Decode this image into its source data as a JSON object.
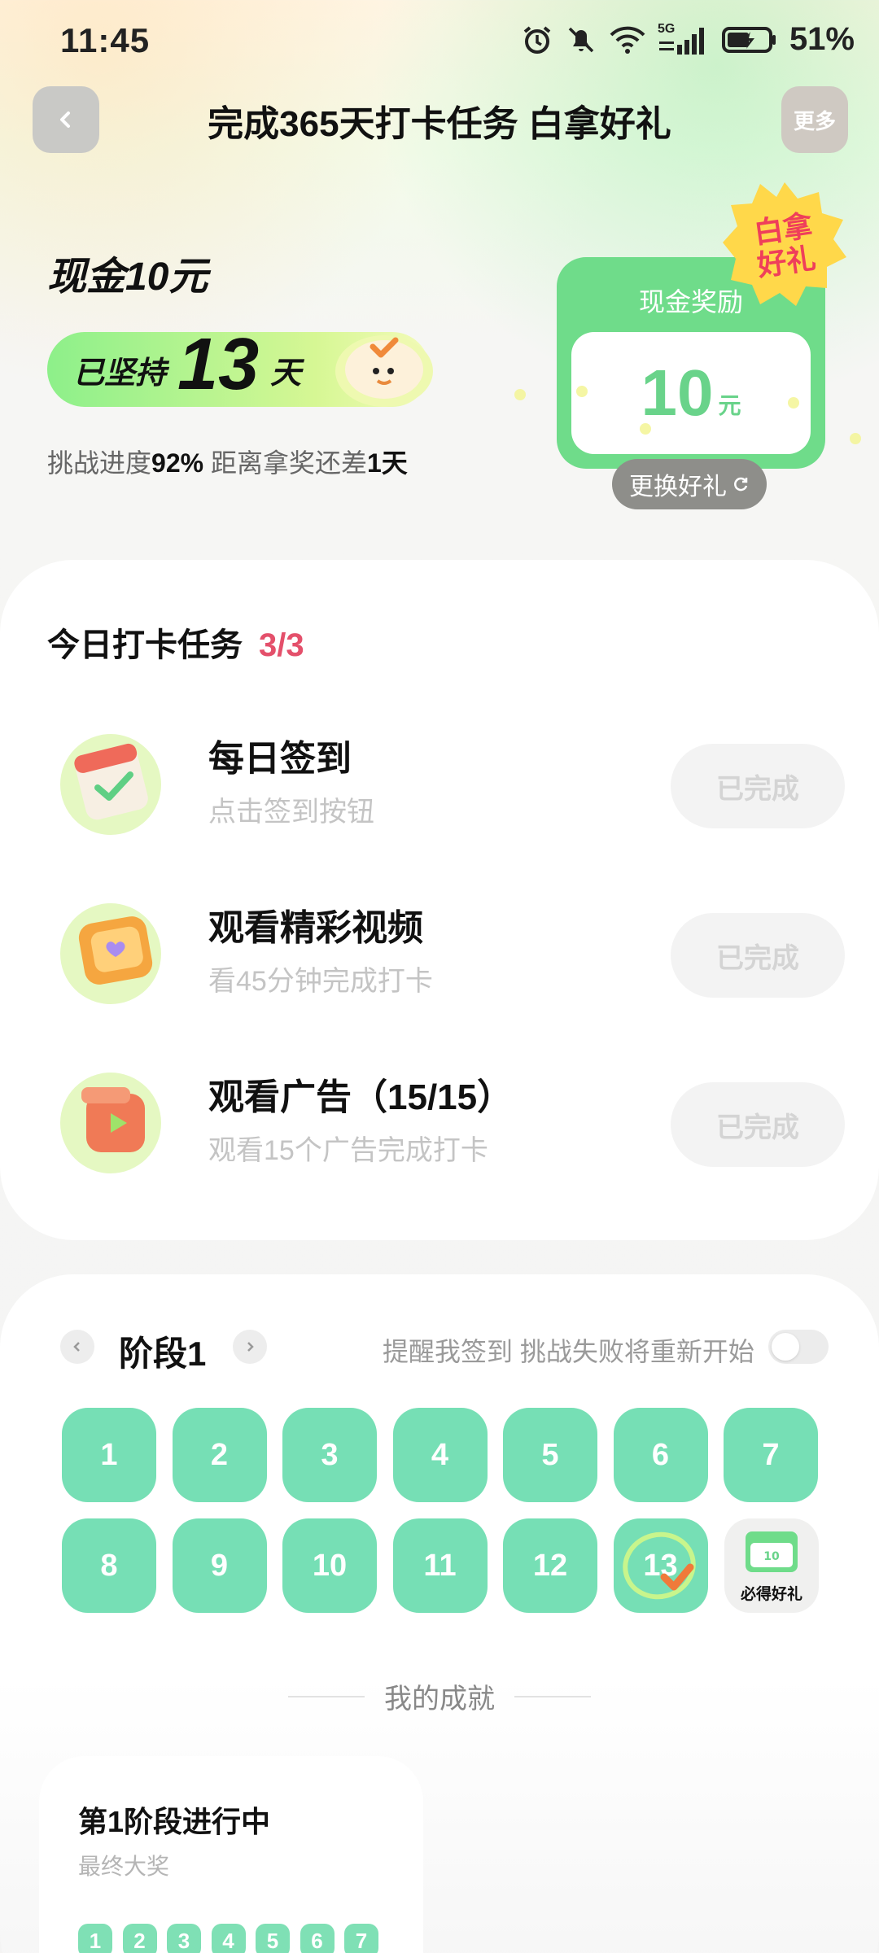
{
  "status_bar": {
    "time": "11:45",
    "signal_label": "5G",
    "battery": "51%"
  },
  "header": {
    "title": "完成365天打卡任务 白拿好礼",
    "more_label": "更多"
  },
  "hero": {
    "cash_title": "现金10元",
    "streak_prefix": "已坚持",
    "streak_days": "13",
    "streak_suffix": "天",
    "progress_label": "挑战进度",
    "progress_value": "92%",
    "progress_gap": "距离拿奖还差",
    "progress_remaining": "1天",
    "reward": {
      "label": "现金奖励",
      "amount": "10",
      "unit": "元"
    },
    "badge_line1": "白拿",
    "badge_line2": "好礼",
    "change_label": "更换好礼"
  },
  "tasks": {
    "title": "今日打卡任务",
    "count": "3/3",
    "items": [
      {
        "name": "每日签到",
        "desc": "点击签到按钮",
        "status": "已完成",
        "icon": "calendar-icon"
      },
      {
        "name": "观看精彩视频",
        "desc": "看45分钟完成打卡",
        "status": "已完成",
        "icon": "video-icon"
      },
      {
        "name": "观看广告（15/15）",
        "desc": "观看15个广告完成打卡",
        "status": "已完成",
        "icon": "ad-play-icon"
      }
    ]
  },
  "stage": {
    "title": "阶段1",
    "reminder": "提醒我签到 挑战失败将重新开始",
    "reminder_enabled": false,
    "days": [
      "1",
      "2",
      "3",
      "4",
      "5",
      "6",
      "7",
      "8",
      "9",
      "10",
      "11",
      "12",
      "13"
    ],
    "current_day": "13",
    "gift_label": "必得好礼",
    "gift_mini_amount": "10"
  },
  "achievements": {
    "title": "我的成就",
    "card_title": "第1阶段进行中",
    "card_sub": "最终大奖",
    "mini_days": [
      "1",
      "2",
      "3",
      "4",
      "5",
      "6",
      "7"
    ]
  },
  "colors": {
    "accent_green": "#76dfb5",
    "reward_green": "#6fdc8a",
    "count_red": "#e4506b",
    "badge_yellow": "#ffd84a",
    "badge_red": "#ef3f5a"
  }
}
